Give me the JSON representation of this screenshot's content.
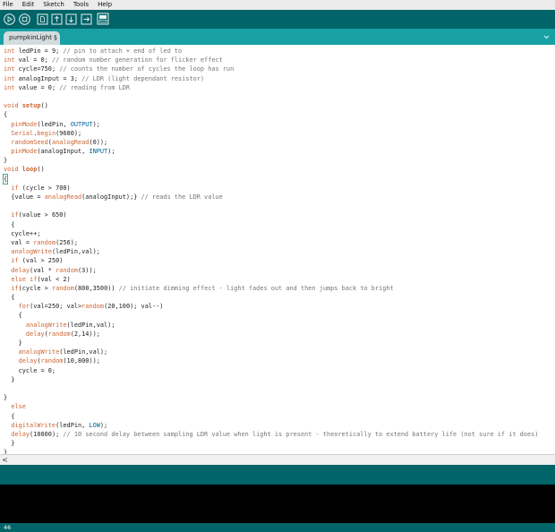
{
  "menu": [
    "File",
    "Edit",
    "Sketch",
    "Tools",
    "Help"
  ],
  "toolbar": {
    "buttons": [
      {
        "icon": "verify-icon"
      },
      {
        "icon": "stop-icon"
      },
      {
        "icon": "new-icon"
      },
      {
        "icon": "open-icon"
      },
      {
        "icon": "save-icon"
      },
      {
        "icon": "upload-icon"
      },
      {
        "icon": "serial-monitor-icon"
      }
    ]
  },
  "tab": {
    "label": "pumpkinLight §"
  },
  "code_lines": [
    [
      [
        "kw",
        "int"
      ],
      [
        "",
        "ledPin = 9; "
      ],
      [
        "cm",
        "// pin to attach + end of led to"
      ]
    ],
    [
      [
        "kw",
        "int"
      ],
      [
        "",
        "val = 0; "
      ],
      [
        "cm",
        "// random number generation for flicker effect"
      ]
    ],
    [
      [
        "kw",
        "int"
      ],
      [
        "",
        "cycle=750; "
      ],
      [
        "cm",
        "// counts the number of cycles the loop has run"
      ]
    ],
    [
      [
        "kw",
        "int"
      ],
      [
        "",
        "analogInput = 3; "
      ],
      [
        "cm",
        "// LDR (light dependant resistor)"
      ]
    ],
    [
      [
        "kw",
        "int"
      ],
      [
        "",
        "value = 0; "
      ],
      [
        "cm",
        "// reading from LDR"
      ]
    ],
    [],
    [
      [
        "kw",
        "void"
      ],
      [
        "",
        ""
      ],
      [
        "kw2",
        "setup"
      ],
      [
        "",
        "()"
      ]
    ],
    [
      [
        "",
        "{"
      ]
    ],
    [
      [
        "fn",
        "  pinMode"
      ],
      [
        "",
        "(ledPin, "
      ],
      [
        "cst",
        "OUTPUT"
      ],
      [
        "",
        "); "
      ]
    ],
    [
      [
        "fn",
        "  Serial"
      ],
      [
        "",
        "."
      ],
      [
        "fn",
        "begin"
      ],
      [
        "",
        "(9600);"
      ]
    ],
    [
      [
        "fn",
        "  randomSeed"
      ],
      [
        "",
        "("
      ],
      [
        "fn",
        "analogRead"
      ],
      [
        "",
        "(0));"
      ]
    ],
    [
      [
        "fn",
        "  pinMode"
      ],
      [
        "",
        "(analogInput, "
      ],
      [
        "cst",
        "INPUT"
      ],
      [
        "",
        "); "
      ]
    ],
    [
      [
        "",
        "}"
      ]
    ],
    [
      [
        "kw",
        "void"
      ],
      [
        "",
        ""
      ],
      [
        "kw2",
        "loop"
      ],
      [
        "",
        "()"
      ]
    ],
    [
      [
        "cursor",
        "{"
      ]
    ],
    [
      [
        "",
        "  "
      ],
      [
        "kw",
        "if"
      ],
      [
        "",
        ""
      ],
      [
        "",
        ""
      ],
      [
        "",
        "(cycle > 700)"
      ]
    ],
    [
      [
        "",
        "  {value = "
      ],
      [
        "fn",
        "analogRead"
      ],
      [
        "",
        "(analogInput);} "
      ],
      [
        "cm",
        "// reads the LDR value"
      ]
    ],
    [],
    [
      [
        "",
        "  "
      ],
      [
        "kw",
        "if"
      ],
      [
        "",
        "(value > 650)"
      ]
    ],
    [
      [
        "",
        "  {"
      ]
    ],
    [
      [
        "",
        "  cycle++;"
      ]
    ],
    [
      [
        "",
        "  val = "
      ],
      [
        "fn",
        "random"
      ],
      [
        "",
        "(256);"
      ]
    ],
    [
      [
        "fn",
        "  analogWrite"
      ],
      [
        "",
        "(ledPin,val);"
      ]
    ],
    [
      [
        "",
        "  "
      ],
      [
        "kw",
        "if"
      ],
      [
        "",
        ""
      ],
      [
        "",
        "(val > 250)"
      ]
    ],
    [
      [
        "fn",
        "  delay"
      ],
      [
        "",
        ""
      ],
      [
        "",
        "(val * "
      ],
      [
        "fn",
        "random"
      ],
      [
        "",
        "(3));"
      ]
    ],
    [
      [
        "",
        "  "
      ],
      [
        "kw",
        "else if"
      ],
      [
        "",
        "(val < 2)"
      ]
    ],
    [
      [
        "",
        "  "
      ],
      [
        "kw",
        "if"
      ],
      [
        "",
        "(cycle > "
      ],
      [
        "fn",
        "random"
      ],
      [
        "",
        "(800,3500)) "
      ],
      [
        "cm",
        "// initiate dimming effect - light fades out and then jumps back to bright"
      ]
    ],
    [
      [
        "",
        "  {"
      ]
    ],
    [
      [
        "",
        "    "
      ],
      [
        "kw",
        "for"
      ],
      [
        "",
        "(val=250; val>"
      ],
      [
        "fn",
        "random"
      ],
      [
        "",
        "(20,100); val--)"
      ]
    ],
    [
      [
        "",
        "    {"
      ]
    ],
    [
      [
        "fn",
        "      analogWrite"
      ],
      [
        "",
        "(ledPin,val);"
      ]
    ],
    [
      [
        "fn",
        "      delay"
      ],
      [
        "",
        "("
      ],
      [
        "fn",
        "random"
      ],
      [
        "",
        "(2,14));"
      ]
    ],
    [
      [
        "",
        "    }"
      ]
    ],
    [
      [
        "fn",
        "    analogWrite"
      ],
      [
        "",
        "(ledPin,val);"
      ]
    ],
    [
      [
        "fn",
        "    delay"
      ],
      [
        "",
        "("
      ],
      [
        "fn",
        "random"
      ],
      [
        "",
        "(10,800));"
      ]
    ],
    [
      [
        "",
        "    cycle = 0;"
      ]
    ],
    [
      [
        "",
        "  }"
      ]
    ],
    [],
    [
      [
        "",
        "}"
      ]
    ],
    [
      [
        "",
        "  "
      ],
      [
        "kw",
        "else"
      ]
    ],
    [
      [
        "",
        "  {"
      ]
    ],
    [
      [
        "fn",
        "  digitalWrite"
      ],
      [
        "",
        "(ledPin, "
      ],
      [
        "cst",
        "LOW"
      ],
      [
        "",
        ");"
      ]
    ],
    [
      [
        "fn",
        "  delay"
      ],
      [
        "",
        "(10000); "
      ],
      [
        "cm",
        "// 10 second delay between sampling LDR value when light is present - theoretically to extend battery life (not sure if it does)"
      ]
    ],
    [
      [
        "",
        "  }"
      ]
    ],
    [
      [
        "",
        "}"
      ]
    ]
  ],
  "scrollbar": {
    "left_arrow": "<"
  },
  "status": {
    "line_number": "46"
  }
}
